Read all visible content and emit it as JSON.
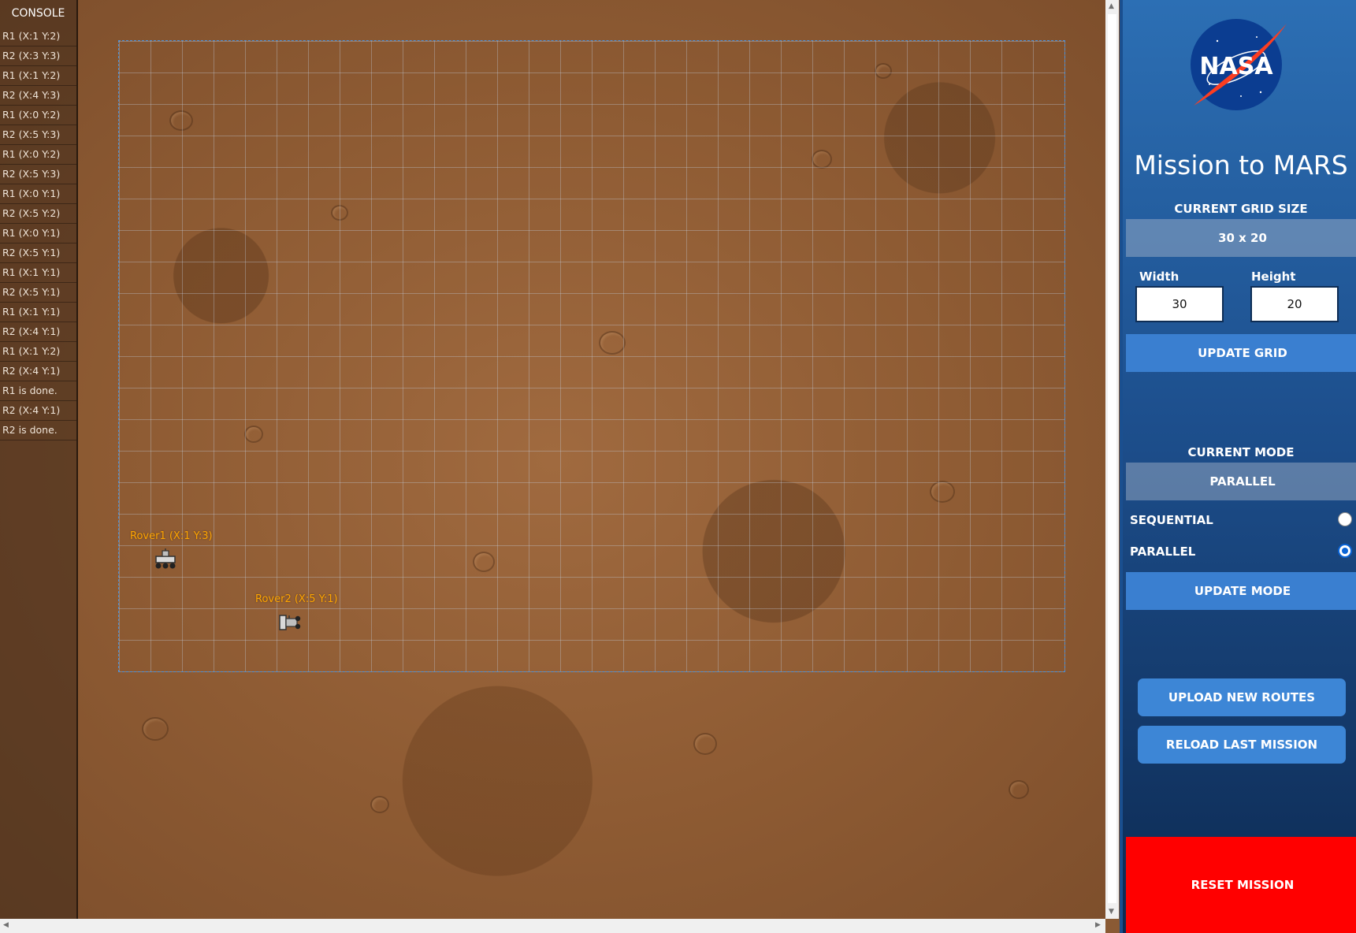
{
  "console": {
    "title": "CONSOLE",
    "items": [
      "R1 (X:1 Y:2)",
      "R2 (X:3 Y:3)",
      "R1 (X:1 Y:2)",
      "R2 (X:4 Y:3)",
      "R1 (X:0 Y:2)",
      "R2 (X:5 Y:3)",
      "R1 (X:0 Y:2)",
      "R2 (X:5 Y:3)",
      "R1 (X:0 Y:1)",
      "R2 (X:5 Y:2)",
      "R1 (X:0 Y:1)",
      "R2 (X:5 Y:1)",
      "R1 (X:1 Y:1)",
      "R2 (X:5 Y:1)",
      "R1 (X:1 Y:1)",
      "R2 (X:4 Y:1)",
      "R1 (X:1 Y:2)",
      "R2 (X:4 Y:1)",
      "R1 is done.",
      "R2 (X:4 Y:1)",
      "R2 is done."
    ]
  },
  "map": {
    "grid_cols": 30,
    "grid_rows": 20,
    "rovers": [
      {
        "label": "Rover1 (X:1 Y:3)",
        "icon": "rover-icon"
      },
      {
        "label": "Rover2 (X:5 Y:1)",
        "icon": "rover-icon"
      }
    ]
  },
  "panel": {
    "logo_text": "NASA",
    "title": "Mission to MARS",
    "grid": {
      "label": "CURRENT GRID SIZE",
      "value": "30 x 20",
      "width_label": "Width",
      "width_value": "30",
      "height_label": "Height",
      "height_value": "20",
      "update_label": "UPDATE GRID"
    },
    "mode": {
      "label": "CURRENT MODE",
      "value": "PARALLEL",
      "options": [
        {
          "label": "SEQUENTIAL",
          "selected": false
        },
        {
          "label": "PARALLEL",
          "selected": true
        }
      ],
      "update_label": "UPDATE MODE"
    },
    "upload_label": "UPLOAD NEW ROUTES",
    "reload_label": "RELOAD LAST MISSION",
    "reset_label": "RESET MISSION"
  },
  "colors": {
    "accent": "#3a7fd0",
    "reset": "#ff0000",
    "rover_label": "#ffa500"
  }
}
